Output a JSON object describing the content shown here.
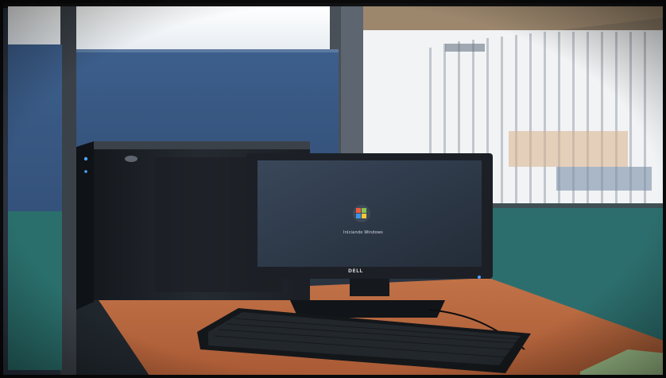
{
  "photo": {
    "subject": "office cubicle desk with desktop computer tower, monitor and keyboard",
    "monitor": {
      "boot_text": "Iniciando Windows",
      "brand": "DELL"
    },
    "colors": {
      "partition_blue": "#3a5a86",
      "partition_teal": "#2a6f6c",
      "desk_orange": "#b9683f",
      "tower_black": "#1d2126",
      "screen_dark": "#2e3947",
      "window_light": "#f4f7fa"
    }
  }
}
